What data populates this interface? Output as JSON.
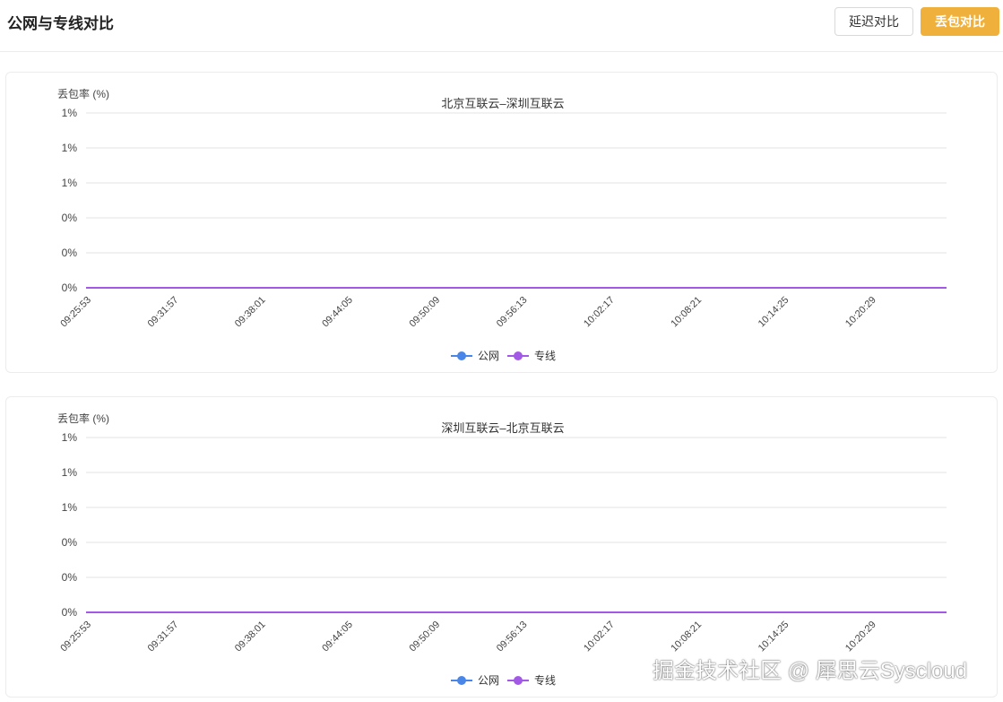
{
  "header": {
    "title": "公网与专线对比",
    "latency_button": "延迟对比",
    "loss_button": "丢包对比"
  },
  "colors": {
    "accent": "#f0b13c",
    "public_series": "#4a86e8",
    "private_series": "#a259e6"
  },
  "watermark": "掘金技术社区 @ 犀思云Syscloud",
  "chart_data": [
    {
      "type": "line",
      "title": "北京互联云–深圳互联云",
      "ylabel": "丢包率 (%)",
      "xlabel": "",
      "y_tick_labels": [
        "1%",
        "1%",
        "1%",
        "0%",
        "0%",
        "0%"
      ],
      "ylim": [
        0,
        1
      ],
      "grid": true,
      "legend_position": "bottom",
      "x": [
        "09:25:53",
        "09:31:57",
        "09:38:01",
        "09:44:05",
        "09:50:09",
        "09:56:13",
        "10:02:17",
        "10:08:21",
        "10:14:25",
        "10:20:29"
      ],
      "series": [
        {
          "name": "公网",
          "color": "#4a86e8",
          "values": [
            0,
            0,
            0,
            0,
            0,
            0,
            0,
            0,
            0,
            0
          ]
        },
        {
          "name": "专线",
          "color": "#a259e6",
          "values": [
            0,
            0,
            0,
            0,
            0,
            0,
            0,
            0,
            0,
            0
          ]
        }
      ]
    },
    {
      "type": "line",
      "title": "深圳互联云–北京互联云",
      "ylabel": "丢包率 (%)",
      "xlabel": "",
      "y_tick_labels": [
        "1%",
        "1%",
        "1%",
        "0%",
        "0%",
        "0%"
      ],
      "ylim": [
        0,
        1
      ],
      "grid": true,
      "legend_position": "bottom",
      "x": [
        "09:25:53",
        "09:31:57",
        "09:38:01",
        "09:44:05",
        "09:50:09",
        "09:56:13",
        "10:02:17",
        "10:08:21",
        "10:14:25",
        "10:20:29"
      ],
      "series": [
        {
          "name": "公网",
          "color": "#4a86e8",
          "values": [
            0,
            0,
            0,
            0,
            0,
            0,
            0,
            0,
            0,
            0
          ]
        },
        {
          "name": "专线",
          "color": "#a259e6",
          "values": [
            0,
            0,
            0,
            0,
            0,
            0,
            0,
            0,
            0,
            0
          ]
        }
      ]
    }
  ]
}
